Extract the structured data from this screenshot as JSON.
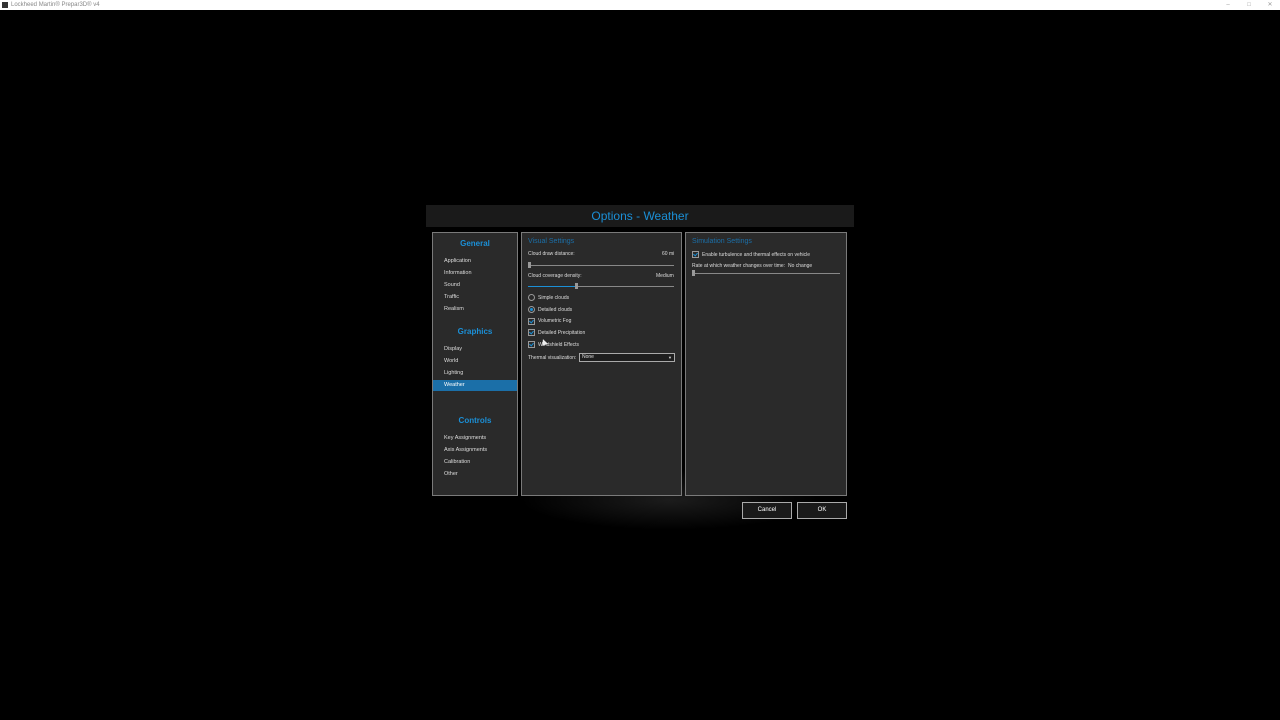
{
  "window": {
    "title": "Lockheed Martin® Prepar3D® v4"
  },
  "dialog": {
    "title": "Options - Weather"
  },
  "nav": {
    "general_header": "General",
    "general_items": [
      "Application",
      "Information",
      "Sound",
      "Traffic",
      "Realism"
    ],
    "graphics_header": "Graphics",
    "graphics_items": [
      "Display",
      "World",
      "Lighting",
      "Weather"
    ],
    "controls_header": "Controls",
    "controls_items": [
      "Key Assignments",
      "Axis Assignments",
      "Calibration",
      "Other"
    ],
    "active_item": "Weather"
  },
  "visual": {
    "title": "Visual Settings",
    "cloud_draw_label": "Cloud draw distance:",
    "cloud_draw_value": "60 mi",
    "cloud_draw_fraction": 0.0,
    "cloud_coverage_label": "Cloud coverage density:",
    "cloud_coverage_value": "Medium",
    "cloud_coverage_fraction": 0.33,
    "simple_clouds": "Simple clouds",
    "detailed_clouds": "Detailed clouds",
    "cloud_mode_selected": "Detailed clouds",
    "volumetric_fog": "Volumetric Fog",
    "volumetric_fog_checked": true,
    "detailed_precipitation": "Detailed Precipitation",
    "detailed_precipitation_checked": true,
    "windshield_effects": "Windshield Effects",
    "windshield_effects_checked": true,
    "thermal_label": "Thermal visualization:",
    "thermal_value": "None"
  },
  "sim": {
    "title": "Simulation Settings",
    "turbulence_label": "Enable turbulence and thermal effects on vehicle",
    "turbulence_checked": true,
    "rate_label": "Rate at which weather changes over time:",
    "rate_value": "No change",
    "rate_fraction": 0.0
  },
  "buttons": {
    "cancel": "Cancel",
    "ok": "OK"
  },
  "colors": {
    "accent": "#1b8fd6",
    "active_nav": "#1b6fa8",
    "panel_bg": "#2a2a2a"
  }
}
